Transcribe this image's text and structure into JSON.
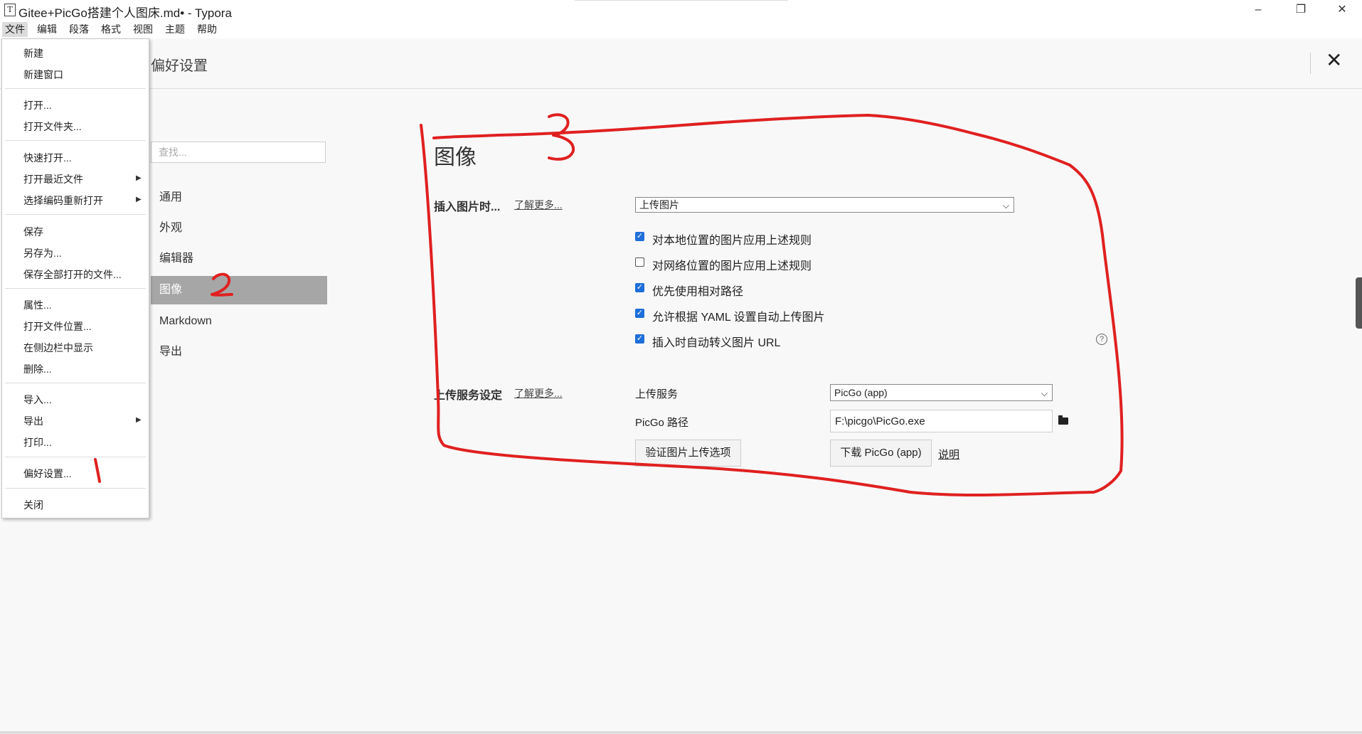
{
  "window": {
    "app_icon": "T",
    "title": "Gitee+PicGo搭建个人图床.md• - Typora",
    "minimize": "–",
    "restore": "❐",
    "close": "✕"
  },
  "menubar": [
    "文件",
    "编辑",
    "段落",
    "格式",
    "视图",
    "主题",
    "帮助"
  ],
  "file_menu": {
    "items": [
      "新建",
      "新建窗口",
      "打开...",
      "打开文件夹...",
      "快速打开...",
      "打开最近文件",
      "选择编码重新打开",
      "保存",
      "另存为...",
      "保存全部打开的文件...",
      "属性...",
      "打开文件位置...",
      "在侧边栏中显示",
      "删除...",
      "导入...",
      "导出",
      "打印...",
      "偏好设置...",
      "关闭"
    ],
    "arrow": "▶"
  },
  "preferences": {
    "title": "偏好设置",
    "close": "✕",
    "search_placeholder": "查找...",
    "nav": [
      "通用",
      "外观",
      "编辑器",
      "图像",
      "Markdown",
      "导出"
    ],
    "selected_nav": "图像"
  },
  "image_section": {
    "title": "图像",
    "insert_label": "插入图片时...",
    "learn_more": "了解更多...",
    "insert_action": "上传图片",
    "options": [
      {
        "label": "对本地位置的图片应用上述规则",
        "checked": true
      },
      {
        "label": "对网络位置的图片应用上述规则",
        "checked": false
      },
      {
        "label": "优先使用相对路径",
        "checked": true
      },
      {
        "label": "允许根据 YAML 设置自动上传图片",
        "checked": true
      },
      {
        "label": "插入时自动转义图片 URL",
        "checked": true
      }
    ],
    "check_mark": "✓",
    "help": "?",
    "upload_label": "上传服务设定",
    "upload_learn_more": "了解更多...",
    "service_label": "上传服务",
    "service_value": "PicGo (app)",
    "path_label": "PicGo 路径",
    "path_value": "F:\\picgo\\PicGo.exe",
    "verify_button": "验证图片上传选项",
    "download_button": "下载 PicGo (app)",
    "explain_link": "说明",
    "caret": "⌵"
  },
  "annotation_colors": {
    "pen": "#e02020"
  }
}
